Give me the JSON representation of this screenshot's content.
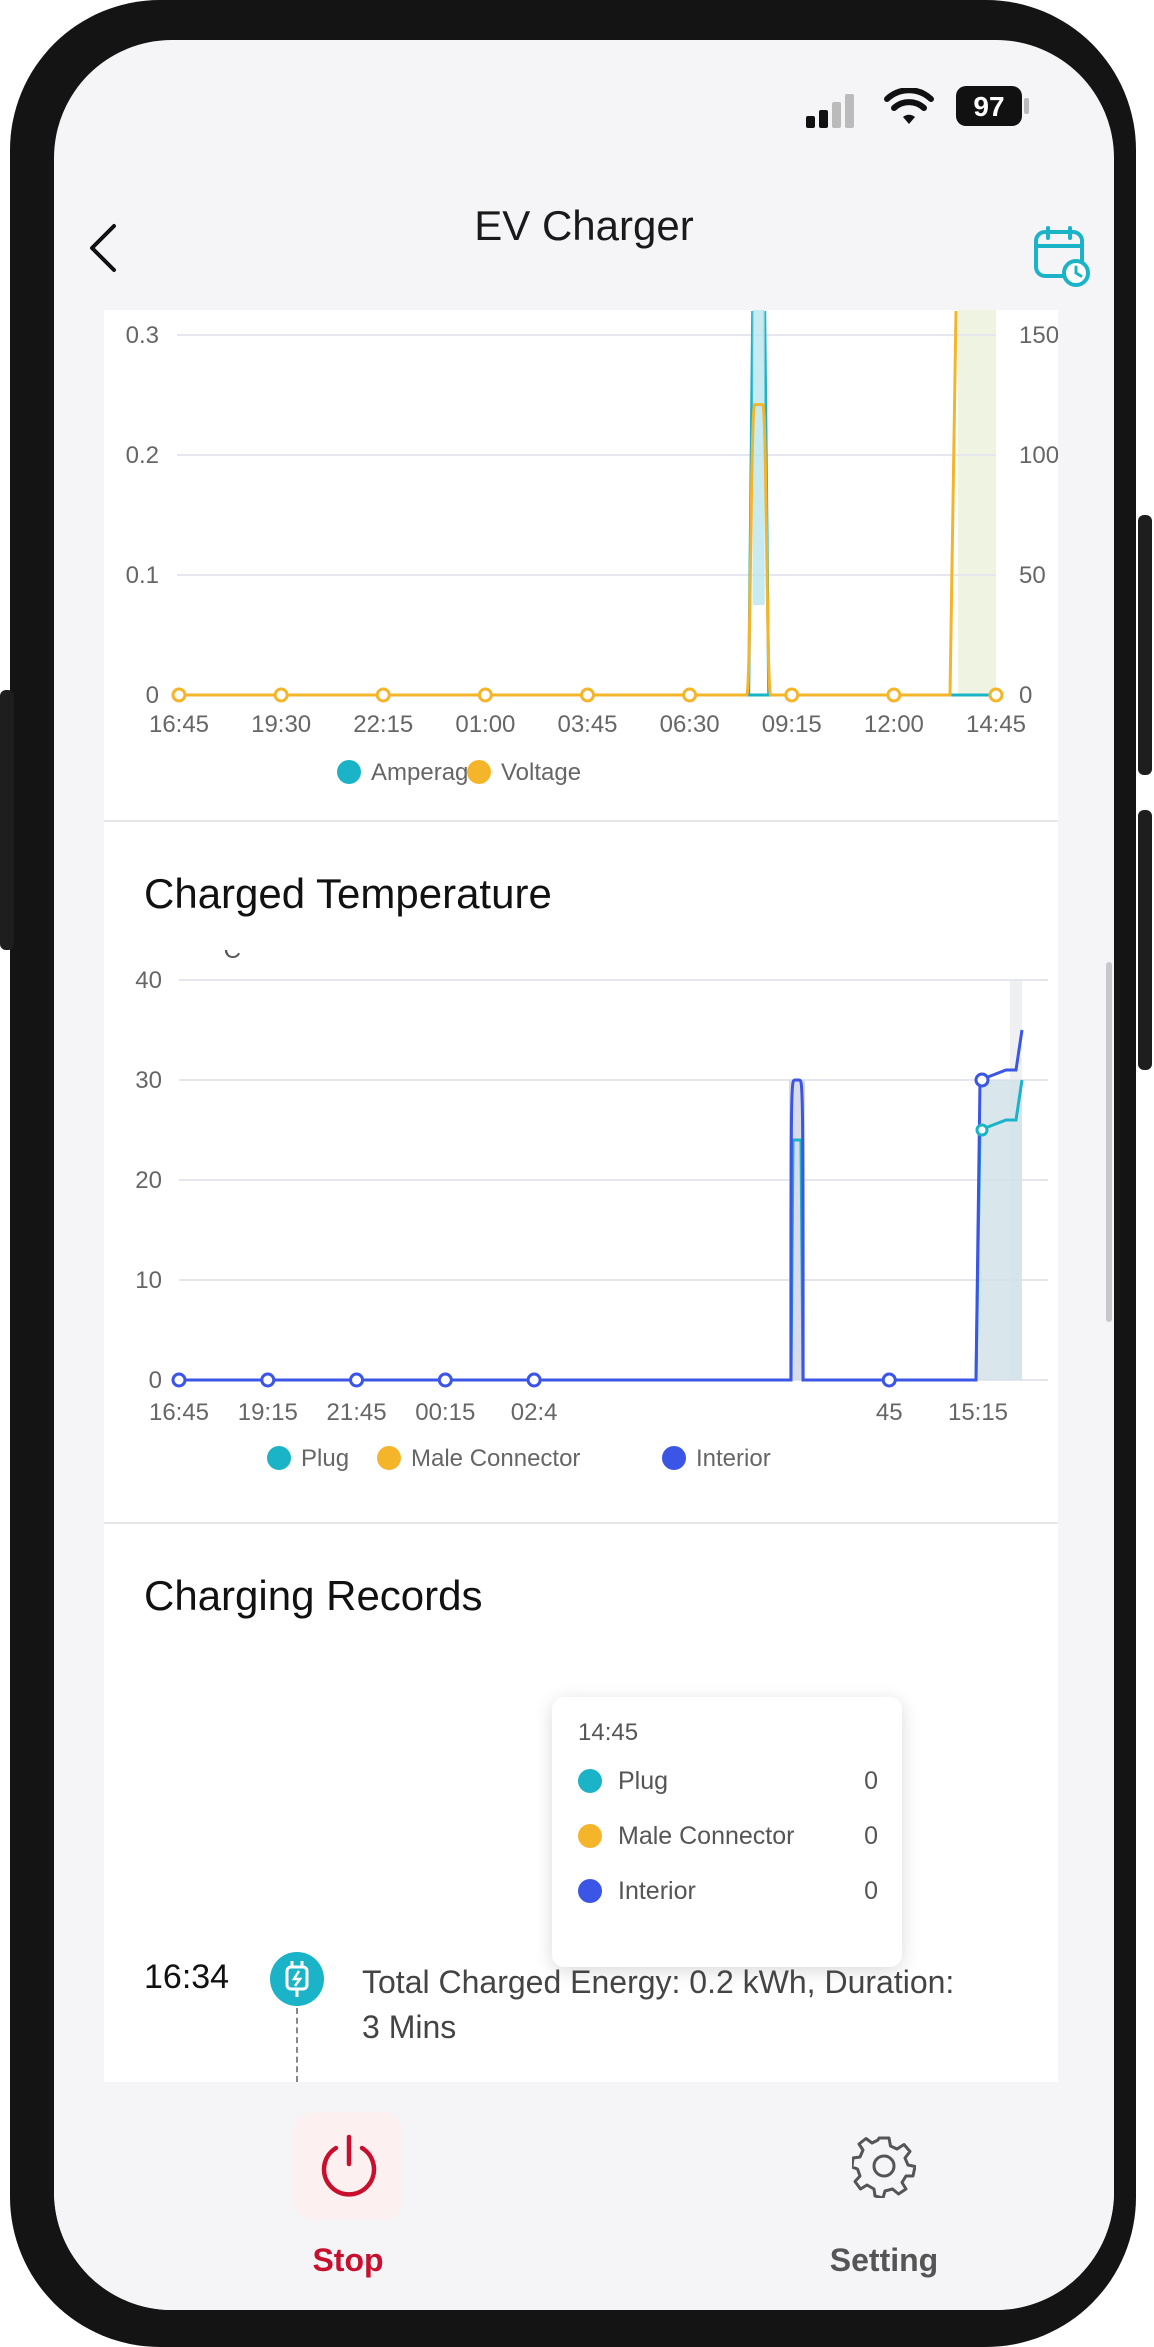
{
  "status_bar": {
    "battery": "97",
    "signal_icon": "signal-bars-icon",
    "wifi_icon": "wifi-icon"
  },
  "header": {
    "title": "EV Charger",
    "back_icon": "chevron-left-icon",
    "calendar_icon": "calendar-clock-icon",
    "accent": "#1ab3c8"
  },
  "power_chart": {
    "chart_data": {
      "type": "line",
      "x": [
        "16:45",
        "19:30",
        "22:15",
        "01:00",
        "03:45",
        "06:30",
        "09:15",
        "12:00",
        "14:45"
      ],
      "y_left_ticks": [
        "0",
        "0.1",
        "0.2",
        "0.3"
      ],
      "y_right_ticks": [
        "0",
        "50",
        "100",
        "150"
      ],
      "ylim_left": [
        0,
        0.3
      ],
      "ylim_right": [
        0,
        150
      ],
      "series": [
        {
          "name": "Amperage",
          "color": "#1ab3c8",
          "axis": "left",
          "values": [
            0,
            0,
            0,
            0,
            0,
            0,
            0,
            0,
            0
          ],
          "spikes": [
            {
              "at": "08:05",
              "value": 0.32
            },
            {
              "at": "15:00",
              "value": 0.32
            }
          ]
        },
        {
          "name": "Voltage",
          "color": "#f5b52b",
          "axis": "right",
          "values": [
            0,
            0,
            0,
            0,
            0,
            0,
            0,
            0,
            0
          ],
          "spikes": [
            {
              "at": "08:05",
              "value": 121
            },
            {
              "at": "15:00",
              "value": 160
            }
          ]
        }
      ],
      "legend": [
        "Amperage",
        "Voltage"
      ],
      "legend_position": "bottom-center"
    }
  },
  "temperature": {
    "title": "Charged Temperature",
    "unit": "°C",
    "chart_data": {
      "type": "line",
      "x": [
        "16:45",
        "19:15",
        "21:45",
        "00:15",
        "02:4",
        "",
        "",
        "",
        "45",
        "15:15"
      ],
      "y_ticks": [
        "0",
        "10",
        "20",
        "30",
        "40"
      ],
      "ylim": [
        0,
        40
      ],
      "series": [
        {
          "name": "Plug",
          "color": "#1ab3c8",
          "values": [
            0,
            0,
            0,
            0,
            0,
            0,
            0,
            0,
            0,
            25
          ],
          "spikes": [
            {
              "at": "08:05",
              "value": 24
            }
          ]
        },
        {
          "name": "Male Connector",
          "color": "#f5b52b",
          "values": [
            0,
            0,
            0,
            0,
            0,
            0,
            0,
            0,
            0,
            0
          ]
        },
        {
          "name": "Interior",
          "color": "#3b55e6",
          "values": [
            0,
            0,
            0,
            0,
            0,
            0,
            0,
            0,
            0,
            30
          ],
          "spikes": [
            {
              "at": "08:05",
              "value": 30
            }
          ]
        }
      ],
      "legend": [
        "Plug",
        "Male Connector",
        "Interior"
      ],
      "legend_position": "bottom-center"
    },
    "tooltip": {
      "time": "14:45",
      "rows": [
        {
          "label": "Plug",
          "value": "0",
          "color": "#1ab3c8"
        },
        {
          "label": "Male Connector",
          "value": "0",
          "color": "#f5b52b"
        },
        {
          "label": "Interior",
          "value": "0",
          "color": "#3b55e6"
        }
      ]
    }
  },
  "records": {
    "title": "Charging Records",
    "items": [
      {
        "time": "16:34",
        "icon": "charging-plug-icon",
        "text": "Total Charged Energy: 0.2 kWh, Duration: 3 Mins"
      }
    ]
  },
  "bottom_bar": {
    "stop_label": "Stop",
    "stop_icon": "power-icon",
    "stop_color": "#c8102e",
    "setting_label": "Setting",
    "setting_icon": "gear-icon"
  }
}
